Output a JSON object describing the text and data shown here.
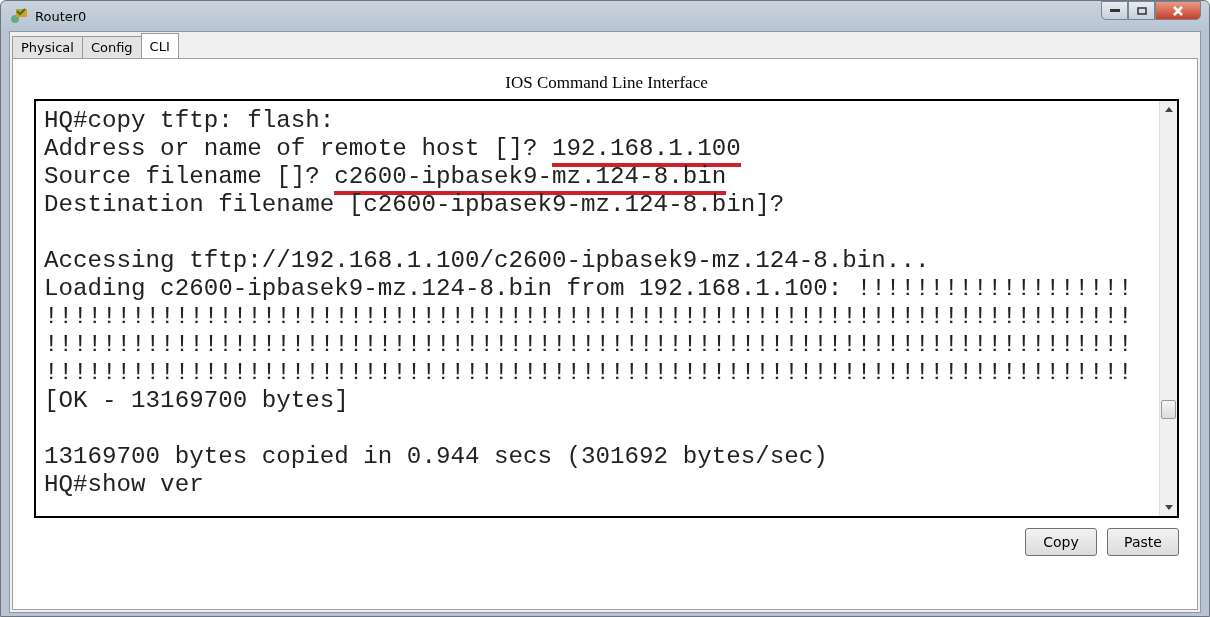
{
  "window": {
    "title": "Router0"
  },
  "tabs": [
    {
      "label": "Physical",
      "selected": false
    },
    {
      "label": "Config",
      "selected": false
    },
    {
      "label": "CLI",
      "selected": true
    }
  ],
  "cli": {
    "heading": "IOS Command Line Interface",
    "lines": [
      {
        "blank_before": false,
        "parts": [
          {
            "text": "HQ#copy tftp: flash:",
            "underlined": false
          }
        ]
      },
      {
        "blank_before": false,
        "parts": [
          {
            "text": "Address or name of remote host []? ",
            "underlined": false
          },
          {
            "text": "192.168.1.100",
            "underlined": true
          }
        ]
      },
      {
        "blank_before": false,
        "parts": [
          {
            "text": "Source filename []? ",
            "underlined": false
          },
          {
            "text": "c2600-ipbasek9-mz.124-8.bin",
            "underlined": true
          }
        ]
      },
      {
        "blank_before": false,
        "parts": [
          {
            "text": "Destination filename [c2600-ipbasek9-mz.124-8.bin]?",
            "underlined": false
          }
        ]
      },
      {
        "blank_before": true,
        "parts": [
          {
            "text": "Accessing tftp://192.168.1.100/c2600-ipbasek9-mz.124-8.bin...",
            "underlined": false
          }
        ]
      },
      {
        "blank_before": false,
        "parts": [
          {
            "text": "Loading c2600-ipbasek9-mz.124-8.bin from 192.168.1.100: !!!!!!!!!!!!!!!!!!!",
            "underlined": false
          }
        ]
      },
      {
        "blank_before": false,
        "parts": [
          {
            "text": "!!!!!!!!!!!!!!!!!!!!!!!!!!!!!!!!!!!!!!!!!!!!!!!!!!!!!!!!!!!!!!!!!!!!!!!!!!!",
            "underlined": false
          }
        ]
      },
      {
        "blank_before": false,
        "parts": [
          {
            "text": "!!!!!!!!!!!!!!!!!!!!!!!!!!!!!!!!!!!!!!!!!!!!!!!!!!!!!!!!!!!!!!!!!!!!!!!!!!!",
            "underlined": false
          }
        ]
      },
      {
        "blank_before": false,
        "parts": [
          {
            "text": "!!!!!!!!!!!!!!!!!!!!!!!!!!!!!!!!!!!!!!!!!!!!!!!!!!!!!!!!!!!!!!!!!!!!!!!!!!!",
            "underlined": false
          }
        ]
      },
      {
        "blank_before": false,
        "parts": [
          {
            "text": "[OK - 13169700 bytes]",
            "underlined": false
          }
        ]
      },
      {
        "blank_before": true,
        "parts": [
          {
            "text": "13169700 bytes copied in 0.944 secs (301692 bytes/sec)",
            "underlined": false
          }
        ]
      },
      {
        "blank_before": false,
        "parts": [
          {
            "text": "HQ#show ver",
            "underlined": false
          }
        ]
      }
    ]
  },
  "buttons": [
    {
      "label": "Copy"
    },
    {
      "label": "Paste"
    }
  ]
}
